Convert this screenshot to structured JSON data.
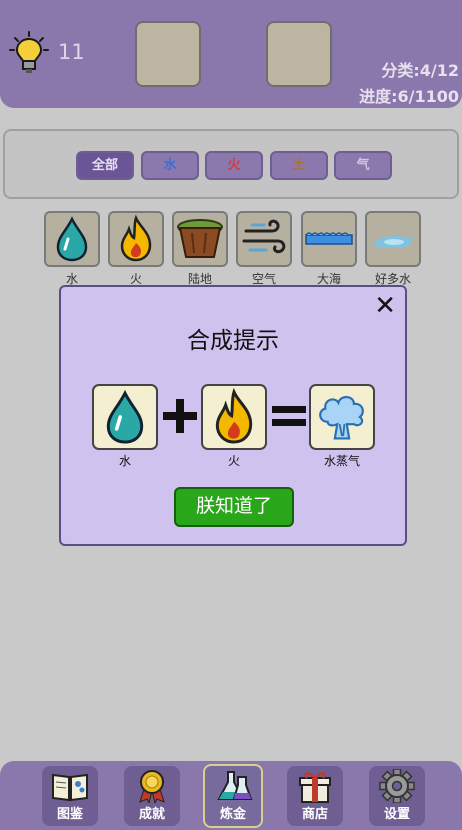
{
  "header": {
    "hint_icon": "lightbulb-icon",
    "hint_count": "11",
    "stat_category": "分类:4/12",
    "stat_progress": "进度:6/1100"
  },
  "filters": [
    {
      "label": "全部",
      "color": "#e6e0f2"
    },
    {
      "label": "水",
      "color": "#3a6fd8"
    },
    {
      "label": "火",
      "color": "#d33c3c"
    },
    {
      "label": "土",
      "color": "#a87236"
    },
    {
      "label": "气",
      "color": "#cfc6e0"
    }
  ],
  "elements": [
    {
      "name": "水",
      "icon": "water-drop-icon"
    },
    {
      "name": "火",
      "icon": "fire-icon"
    },
    {
      "name": "陆地",
      "icon": "land-icon"
    },
    {
      "name": "空气",
      "icon": "wind-icon"
    },
    {
      "name": "大海",
      "icon": "sea-icon"
    },
    {
      "name": "好多水",
      "icon": "puddle-icon"
    }
  ],
  "modal": {
    "title": "合成提示",
    "close": "✕",
    "recipe": {
      "a": {
        "name": "水",
        "icon": "water-drop-icon"
      },
      "b": {
        "name": "火",
        "icon": "fire-icon"
      },
      "result": {
        "name": "水蒸气",
        "icon": "steam-icon"
      },
      "plus": "plus-icon",
      "equals": "equals-icon"
    },
    "ok_label": "朕知道了"
  },
  "nav": [
    {
      "label": "图鉴",
      "icon": "book-icon"
    },
    {
      "label": "成就",
      "icon": "medal-icon"
    },
    {
      "label": "炼金",
      "icon": "flask-icon"
    },
    {
      "label": "商店",
      "icon": "gift-icon"
    },
    {
      "label": "设置",
      "icon": "gear-icon"
    }
  ],
  "colors": {
    "header_bg": "#8a78ac",
    "modal_bg": "#cfc2ef",
    "ok_button": "#2aa61a"
  }
}
